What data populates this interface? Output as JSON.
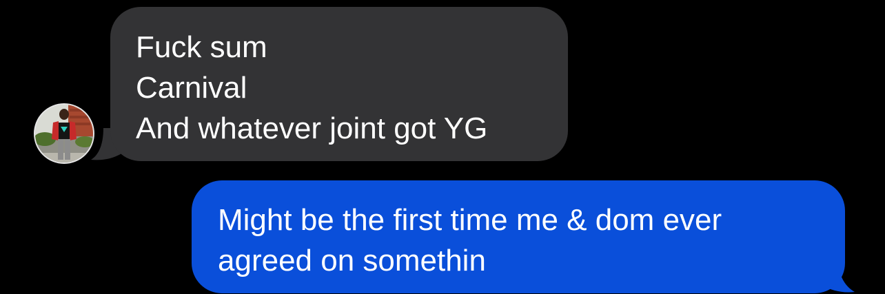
{
  "conversation": {
    "incoming_message": {
      "text": "Fuck sum\nCarnival\nAnd whatever joint got YG",
      "bubble_color": "#333335"
    },
    "outgoing_message": {
      "text": "Might be the first time me & dom ever\nagreed on somethin",
      "bubble_color": "#0a4fda"
    },
    "sender_avatar": {
      "icon": "contact-photo"
    }
  }
}
